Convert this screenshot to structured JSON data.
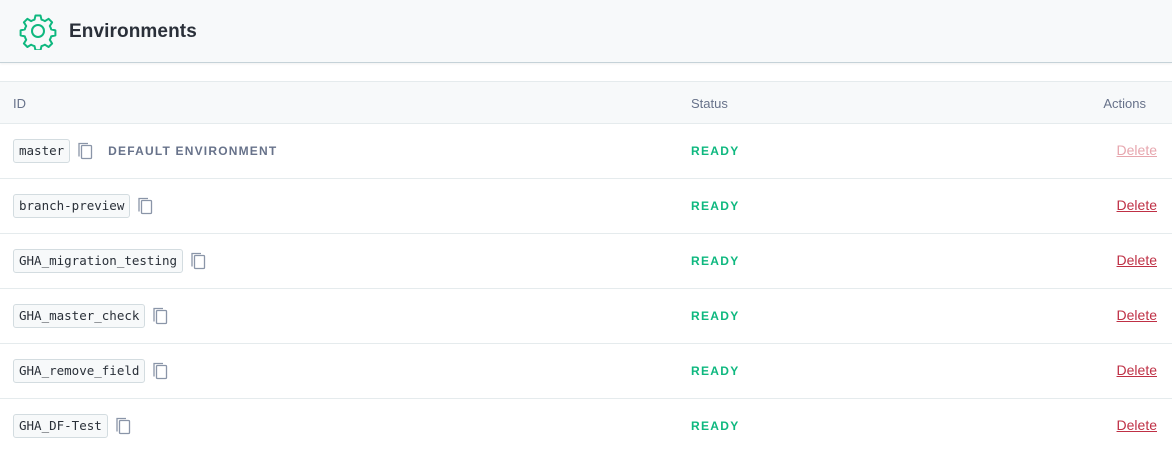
{
  "header": {
    "icon": "gear-icon",
    "title": "Environments",
    "accent_color": "#0eb87f"
  },
  "table": {
    "columns": {
      "id": "ID",
      "status": "Status",
      "actions": "Actions"
    },
    "rows": [
      {
        "id": "master",
        "label": "DEFAULT ENVIRONMENT",
        "status": "READY",
        "action": "Delete",
        "action_disabled": true
      },
      {
        "id": "branch-preview",
        "label": "",
        "status": "READY",
        "action": "Delete",
        "action_disabled": false
      },
      {
        "id": "GHA_migration_testing",
        "label": "",
        "status": "READY",
        "action": "Delete",
        "action_disabled": false
      },
      {
        "id": "GHA_master_check",
        "label": "",
        "status": "READY",
        "action": "Delete",
        "action_disabled": false
      },
      {
        "id": "GHA_remove_field",
        "label": "",
        "status": "READY",
        "action": "Delete",
        "action_disabled": false
      },
      {
        "id": "GHA_DF-Test",
        "label": "",
        "status": "READY",
        "action": "Delete",
        "action_disabled": false
      }
    ]
  },
  "colors": {
    "status_ready": "#0eb87f",
    "delete": "#bf3045",
    "delete_disabled": "#e7a6ae"
  }
}
